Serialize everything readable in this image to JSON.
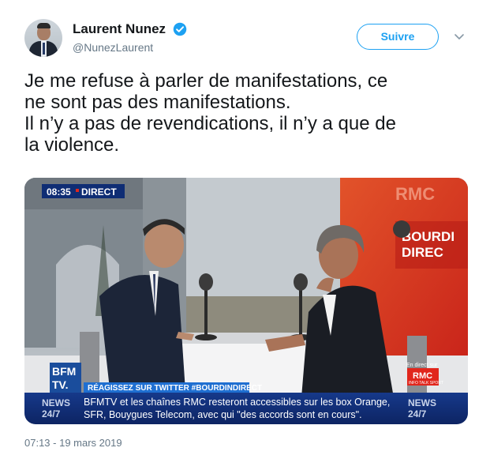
{
  "author": {
    "display_name": "Laurent Nunez",
    "handle": "@NunezLaurent",
    "verified": true
  },
  "actions": {
    "follow_label": "Suivre"
  },
  "tweet": {
    "text": "Je me refuse à parler de manifestations, ce\nne sont pas des manifestations.\nIl n’y a pas de revendications, il n’y a que de\nla violence.",
    "timestamp": "07:13 - 19 mars 2019"
  },
  "media": {
    "live_badge_time": "08:35",
    "live_badge_label": "DIRECT",
    "channel_logo_line1": "BFM",
    "channel_logo_line2": "TV.",
    "hashtag_banner": "RÉAGISSEZ SUR TWITTER #BOURDINDIRECT",
    "ticker_line1": "BFMTV et les chaînes RMC resteront accessibles sur les box Orange,",
    "ticker_line2": "SFR, Bouygues Telecom, avec qui \"des accords sont en cours\".",
    "news_label": "NEWS",
    "news_sub": "24/7",
    "rmc_wall_text": "RMC",
    "studio_sign_line1": "BOURDI",
    "studio_sign_line2": "DIREC",
    "rmc_logo_label": "RMC",
    "rmc_logo_sub": "INFO TALK SPORT",
    "en_direct_label": "En direct sur"
  },
  "colors": {
    "twitter_blue": "#1da1f2",
    "bfm_blue": "#1a4d9c",
    "rmc_red": "#e1261c"
  },
  "icons": {
    "verified": "verified-badge-icon",
    "caret": "chevron-down-icon"
  }
}
